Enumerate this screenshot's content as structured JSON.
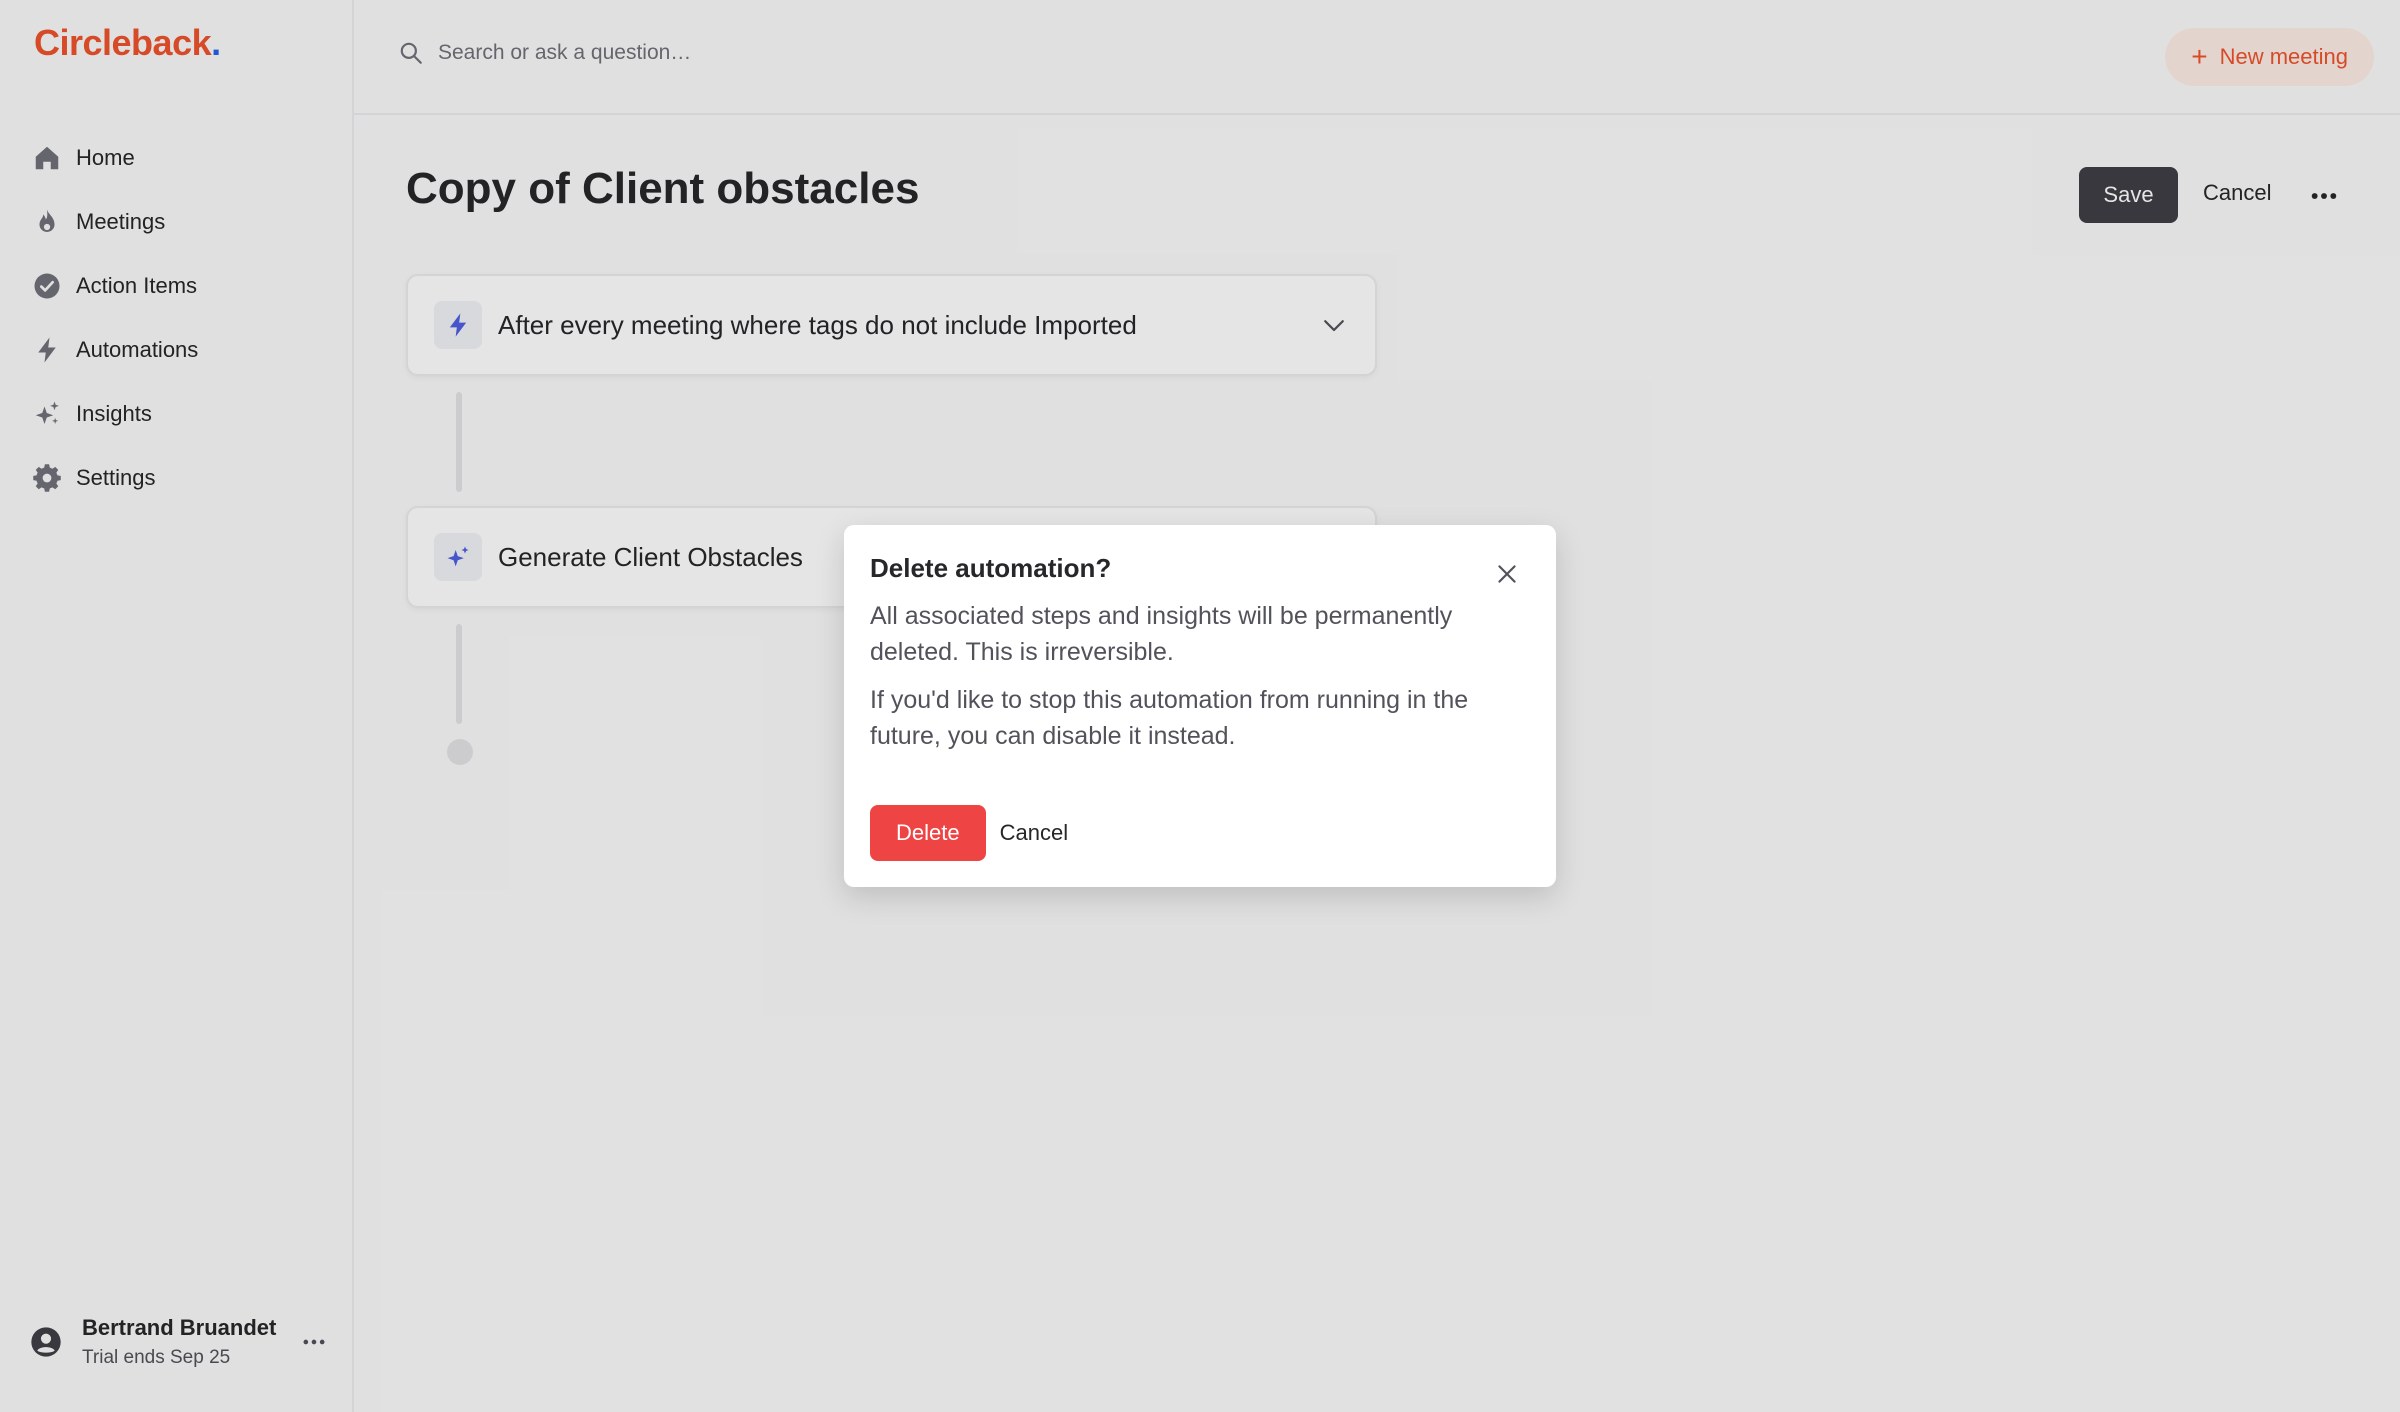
{
  "brand": {
    "name": "Circleback",
    "dot": ".",
    "color": "#f0532d",
    "dot_color": "#2563eb"
  },
  "sidebar": {
    "items": [
      {
        "label": "Home",
        "icon": "home-icon"
      },
      {
        "label": "Meetings",
        "icon": "flame-icon"
      },
      {
        "label": "Action Items",
        "icon": "check-circle-icon"
      },
      {
        "label": "Automations",
        "icon": "bolt-icon"
      },
      {
        "label": "Insights",
        "icon": "sparkles-icon"
      },
      {
        "label": "Settings",
        "icon": "gear-icon"
      }
    ],
    "user": {
      "name": "Bertrand Bruandet",
      "trial": "Trial ends Sep 25"
    }
  },
  "topbar": {
    "search_placeholder": "Search or ask a question…",
    "new_meeting_label": "New meeting"
  },
  "main": {
    "title": "Copy of Client obstacles",
    "save_label": "Save",
    "cancel_label": "Cancel",
    "steps": [
      {
        "label": "After every meeting where tags do not include Imported",
        "icon": "bolt-icon"
      },
      {
        "label": "Generate Client Obstacles",
        "icon": "sparkles-icon"
      }
    ]
  },
  "modal": {
    "title": "Delete automation?",
    "body1": "All associated steps and insights will be permanently deleted. This is irreversible.",
    "body2": "If you'd like to stop this automation from running in the future, you can disable it instead.",
    "delete_label": "Delete",
    "cancel_label": "Cancel"
  },
  "colors": {
    "accent": "#f0532d",
    "danger": "#ef4444",
    "dark_button": "#3f3f46",
    "icon_blue": "#4f5fe0"
  }
}
